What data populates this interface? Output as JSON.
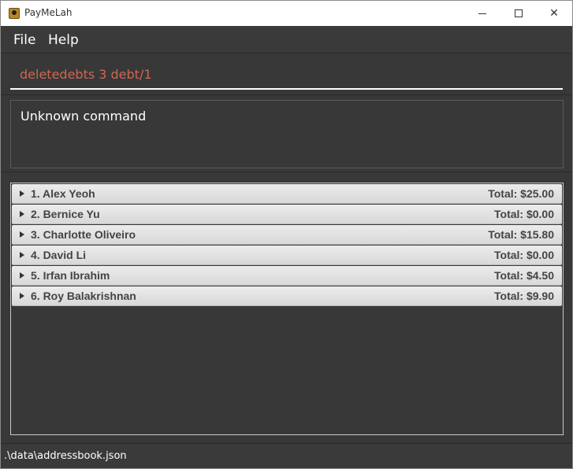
{
  "window": {
    "title": "PayMeLah",
    "close_glyph": "✕"
  },
  "menu": {
    "file": "File",
    "help": "Help"
  },
  "command": {
    "value": "deletedebts 3 debt/1"
  },
  "result": {
    "message": "Unknown command"
  },
  "persons": [
    {
      "name": "1. Alex Yeoh",
      "total": "Total: $25.00"
    },
    {
      "name": "2. Bernice Yu",
      "total": "Total: $0.00"
    },
    {
      "name": "3. Charlotte Oliveiro",
      "total": "Total: $15.80"
    },
    {
      "name": "4. David Li",
      "total": "Total: $0.00"
    },
    {
      "name": "5. Irfan Ibrahim",
      "total": "Total: $4.50"
    },
    {
      "name": "6. Roy Balakrishnan",
      "total": "Total: $9.90"
    }
  ],
  "status": {
    "path": ".\\data\\addressbook.json"
  },
  "colors": {
    "command_text": "#d06651",
    "background": "#383838"
  }
}
